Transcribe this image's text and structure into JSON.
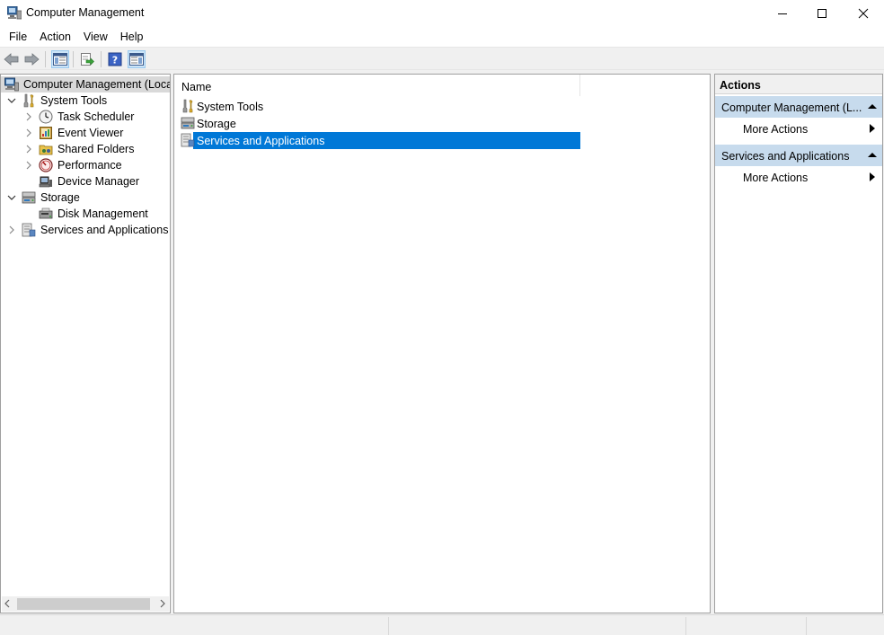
{
  "window": {
    "title": "Computer Management"
  },
  "menu": {
    "items": [
      "File",
      "Action",
      "View",
      "Help"
    ]
  },
  "tree": {
    "root": "Computer Management (Local",
    "system_tools": "System Tools",
    "task_scheduler": "Task Scheduler",
    "event_viewer": "Event Viewer",
    "shared_folders": "Shared Folders",
    "performance": "Performance",
    "device_manager": "Device Manager",
    "storage": "Storage",
    "disk_management": "Disk Management",
    "services_and_applications": "Services and Applications"
  },
  "list": {
    "column_name": "Name",
    "rows": [
      "System Tools",
      "Storage",
      "Services and Applications"
    ],
    "selected_row": "Services and Applications"
  },
  "actions": {
    "title": "Actions",
    "section1": "Computer Management (L...",
    "section1_more": "More Actions",
    "section2": "Services and Applications",
    "section2_more": "More Actions"
  },
  "icons": {
    "app": "computer-management-icon",
    "back": "back-arrow-icon",
    "forward": "forward-arrow-icon",
    "show_hide_tree": "console-tree-icon",
    "export": "export-list-icon",
    "help": "help-icon",
    "show_hide_action": "action-pane-icon"
  },
  "colors": {
    "selection": "#0078d7",
    "section_header": "#c7dbed",
    "root_highlight": "#d9d9d9"
  }
}
